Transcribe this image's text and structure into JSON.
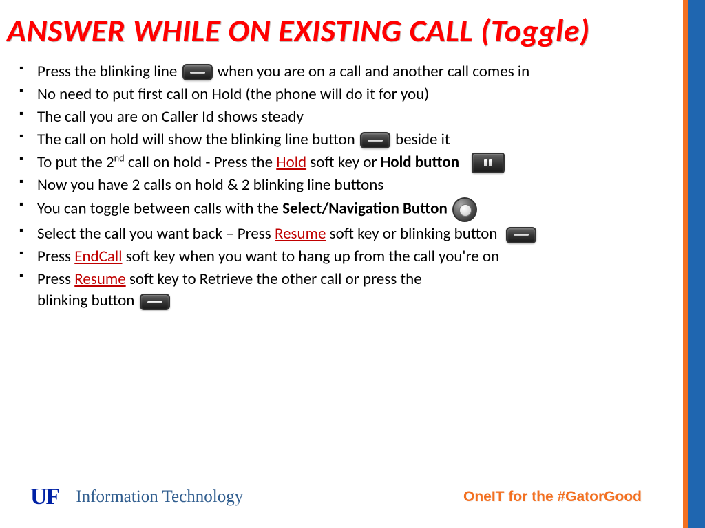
{
  "title": "ANSWER WHILE ON EXISTING CALL (Toggle)",
  "bullets": {
    "b1a": "Press the blinking line",
    "b1b": "when you are on a call and another call comes in",
    "b2": "No need to put first call on Hold (the phone will do it for you)",
    "b3": "The call you are on Caller Id shows steady",
    "b4a": "The call on hold will show the blinking line button",
    "b4b": "  beside it",
    "b5a": "To put the 2",
    "b5sup": "nd",
    "b5b": " call on hold - Press the ",
    "b5_hold": "Hold",
    "b5c": " soft key or ",
    "b5_bold": "Hold button",
    "b6": "Now you have 2 calls on hold & 2 blinking line buttons",
    "b7a": "You can toggle between calls with the  ",
    "b7_bold": "Select/Navigation Button",
    "b8a": "Select the call you want back – Press ",
    "b8_resume": "Resume",
    "b8b": " soft key or blinking button",
    "b9a": "Press ",
    "b9_end": "EndCall",
    "b9b": " soft key when you want to hang up from the call you're on",
    "b10a": "Press ",
    "b10_resume": "Resume",
    "b10b": " soft key to Retrieve the other call or press the",
    "b10c": "blinking button  "
  },
  "footer": {
    "logo_mark": "UF",
    "logo_text": "Information Technology",
    "tagline": "OneIT for the #GatorGood"
  },
  "icons": {
    "line_button": "line-button-icon",
    "pause_button": "pause-button-icon",
    "nav_button": "nav-button-icon"
  },
  "colors": {
    "title_red": "#ff0000",
    "softkey_red": "#c00000",
    "uf_blue": "#0021a5",
    "uf_steel": "#315e8f",
    "orange": "#f37021",
    "stripe_blue": "#1f66b0"
  }
}
